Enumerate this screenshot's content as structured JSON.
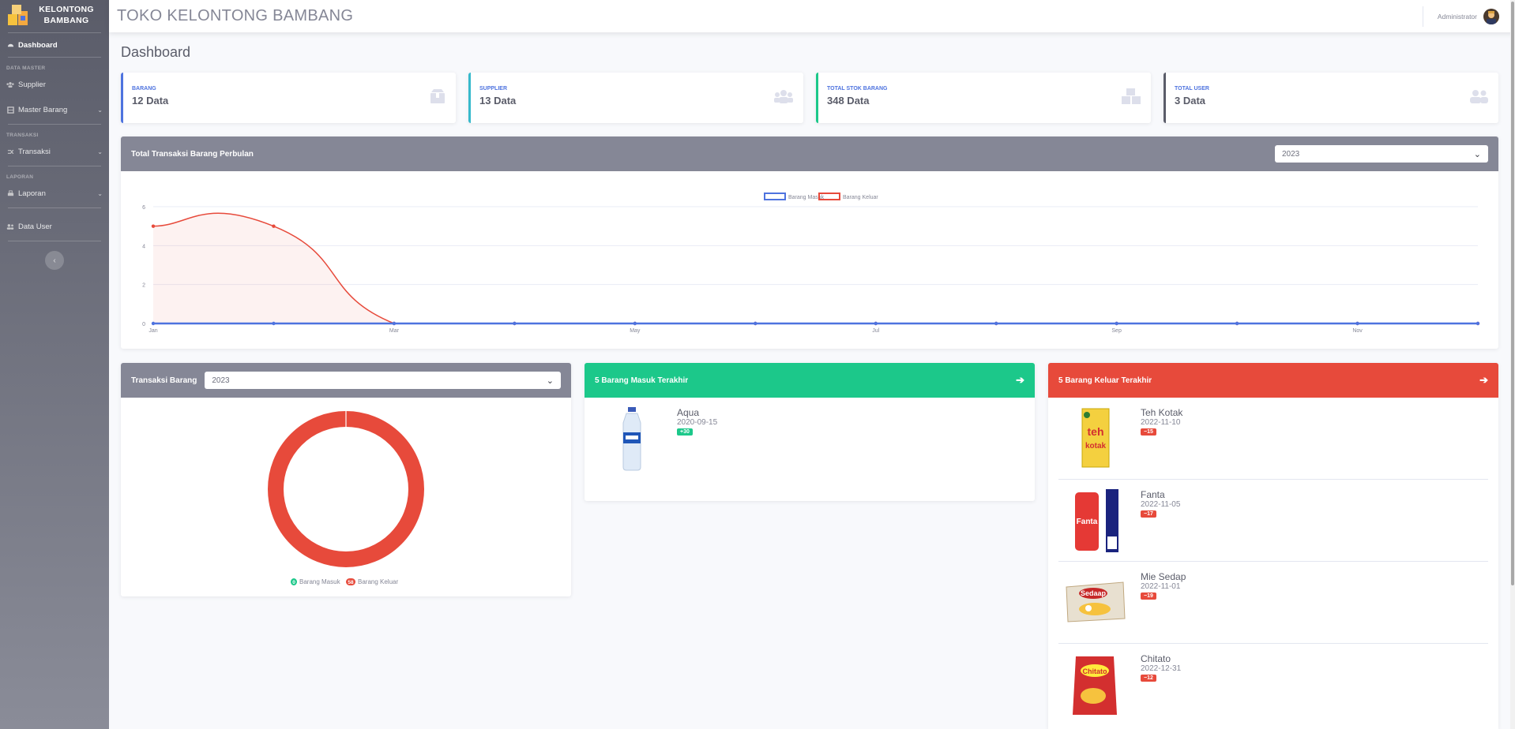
{
  "brand": {
    "name_line1": "KELONTONG",
    "name_line2": "BAMBANG"
  },
  "sidebar": {
    "dashboard": "Dashboard",
    "heading_master": "DATA MASTER",
    "supplier": "Supplier",
    "master_barang": "Master Barang",
    "heading_transaksi": "TRANSAKSI",
    "transaksi": "Transaksi",
    "heading_laporan": "LAPORAN",
    "laporan": "Laporan",
    "data_user": "Data User",
    "toggle": "‹"
  },
  "topbar": {
    "title": "TOKO KELONTONG BAMBANG",
    "user": "Administrator"
  },
  "page": {
    "title": "Dashboard"
  },
  "stats": [
    {
      "label": "BARANG",
      "value": "12 Data",
      "color": "#4e73df",
      "icon": "box-icon"
    },
    {
      "label": "SUPPLIER",
      "value": "13 Data",
      "color": "#36b9cc",
      "icon": "users-icon"
    },
    {
      "label": "TOTAL STOK BARANG",
      "value": "348 Data",
      "color": "#1cc88a",
      "icon": "boxes-icon"
    },
    {
      "label": "TOTAL USER",
      "value": "3 Data",
      "color": "#5a5c69",
      "icon": "user-friends-icon"
    }
  ],
  "line_card": {
    "title": "Total Transaksi Barang Perbulan",
    "year": "2023",
    "header_color": "#858796"
  },
  "chart_data": [
    {
      "type": "line",
      "title": "",
      "x": [
        "Jan",
        "Feb",
        "Mar",
        "Apr",
        "May",
        "Jun",
        "Jul",
        "Aug",
        "Sep",
        "Oct",
        "Nov",
        "Dec"
      ],
      "xtick_labels": [
        "Jan",
        "Mar",
        "May",
        "Jul",
        "Sep",
        "Nov"
      ],
      "series": [
        {
          "name": "Barang Masuk",
          "color": "#4e73df",
          "values": [
            0,
            0,
            0,
            0,
            0,
            0,
            0,
            0,
            0,
            0,
            0,
            0
          ]
        },
        {
          "name": "Barang Keluar",
          "color": "#e74a3b",
          "values": [
            5,
            5,
            0,
            0,
            0,
            0,
            0,
            0,
            0,
            0,
            0,
            0
          ]
        }
      ],
      "ylim": [
        0,
        6
      ],
      "yticks": [
        0,
        2,
        4,
        6
      ],
      "legend": "top-center",
      "grid": true
    },
    {
      "type": "pie",
      "title": "",
      "categories": [
        "Barang Masuk",
        "Barang Keluar"
      ],
      "values": [
        0,
        58
      ],
      "colors": [
        "#1cc88a",
        "#e74a3b"
      ],
      "labels": [
        "0",
        "58"
      ],
      "legend": "bottom"
    }
  ],
  "donut_card": {
    "title": "Transaksi Barang",
    "year": "2023",
    "header_color": "#858796"
  },
  "masuk_card": {
    "title": "5 Barang Masuk Terakhir",
    "header_color": "#1cc88a",
    "items": [
      {
        "name": "Aqua",
        "date": "2020-09-15",
        "qty": "30",
        "sign": "+"
      }
    ]
  },
  "keluar_card": {
    "title": "5 Barang Keluar Terakhir",
    "header_color": "#e74a3b",
    "items": [
      {
        "name": "Teh Kotak",
        "date": "2022-11-10",
        "qty": "15",
        "sign": "−"
      },
      {
        "name": "Fanta",
        "date": "2022-11-05",
        "qty": "17",
        "sign": "−"
      },
      {
        "name": "Mie Sedap",
        "date": "2022-11-01",
        "qty": "19",
        "sign": "−"
      },
      {
        "name": "Chitato",
        "date": "2022-12-31",
        "qty": "12",
        "sign": "−"
      }
    ]
  }
}
